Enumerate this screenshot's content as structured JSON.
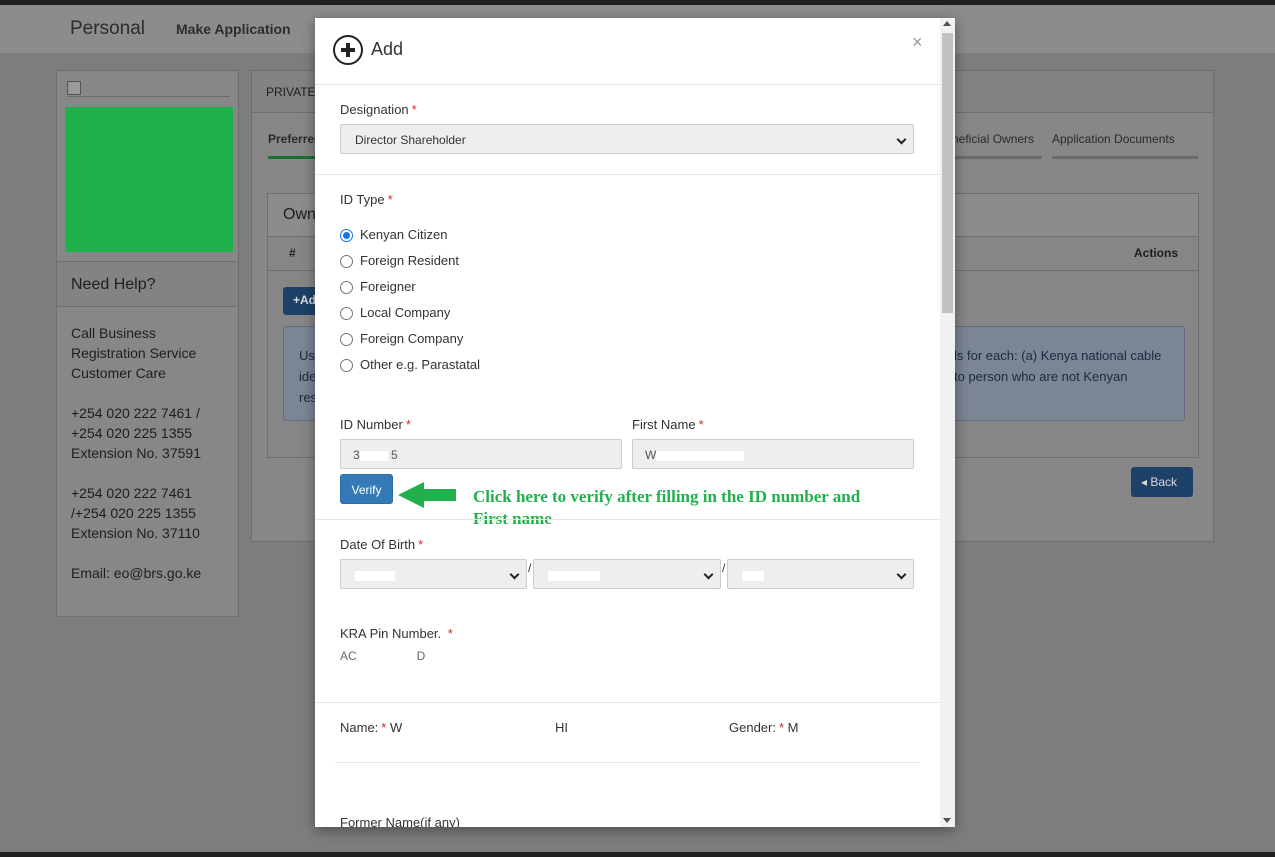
{
  "navbar": {
    "brand": "Personal",
    "make_application": "Make Application"
  },
  "sidebar": {
    "help_title": "Need Help?",
    "contact_lines": [
      "Call Business Registration Service Customer Care",
      "+254 020 222 7461 / +254 020 225 1355 Extension No. 37591",
      "+254 020 222 7461 /+254 020 225 1355 Extension No. 37110",
      "Email: eo@brs.go.ke"
    ]
  },
  "main": {
    "header": "PRIVATE",
    "tabs": [
      "Preferred",
      "neficial Owners",
      "Application Documents"
    ],
    "owners_title": "Own",
    "table_headers": {
      "hash": "#",
      "actions": "Actions"
    },
    "add_button": "+Ad",
    "info_left": "Use ide res",
    "info_right": "ls for each: (a) Kenya national cable to person who are not Kenyan",
    "back_button": "Back"
  },
  "modal": {
    "title": "Add",
    "designation": {
      "label": "Designation",
      "value": "Director Shareholder"
    },
    "id_type": {
      "label": "ID Type",
      "options": [
        "Kenyan Citizen",
        "Foreign Resident",
        "Foreigner",
        "Local Company",
        "Foreign Company",
        "Other e.g. Parastatal"
      ],
      "selected": "Kenyan Citizen"
    },
    "id_number": {
      "label": "ID Number",
      "value_start": "3",
      "value_end": "5"
    },
    "first_name": {
      "label": "First Name",
      "value_start": "W"
    },
    "verify_button": "Verify",
    "annotation": "Click here to verify after filling in the ID number and First name",
    "dob": {
      "label": "Date Of Birth"
    },
    "kra": {
      "label": "KRA Pin Number.",
      "value_start": "AC",
      "value_end": "D"
    },
    "name": {
      "label": "Name:",
      "value": "W",
      "middle": "HI"
    },
    "gender": {
      "label": "Gender:",
      "value": "M"
    },
    "former_name": {
      "label": "Former Name(if any)"
    }
  },
  "colors": {
    "accent": "#337ab7",
    "annotation": "#21b14c",
    "required": "#d9232d"
  }
}
